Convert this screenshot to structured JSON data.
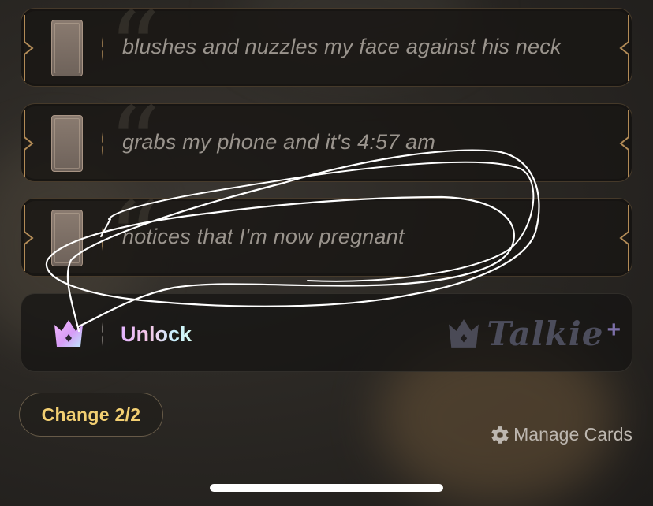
{
  "cards": [
    {
      "text": "blushes and nuzzles my face against his neck"
    },
    {
      "text": "grabs my phone and it's 4:57 am"
    },
    {
      "text": "notices that I'm now pregnant"
    }
  ],
  "unlock": {
    "label": "Unlock",
    "brand": "Talkie",
    "brand_suffix": "+"
  },
  "controls": {
    "change_label": "Change 2/2",
    "manage_label": "Manage Cards"
  },
  "icons": {
    "crown": "crown-icon",
    "gear": "gear-icon",
    "tarot": "tarot-card-icon"
  }
}
